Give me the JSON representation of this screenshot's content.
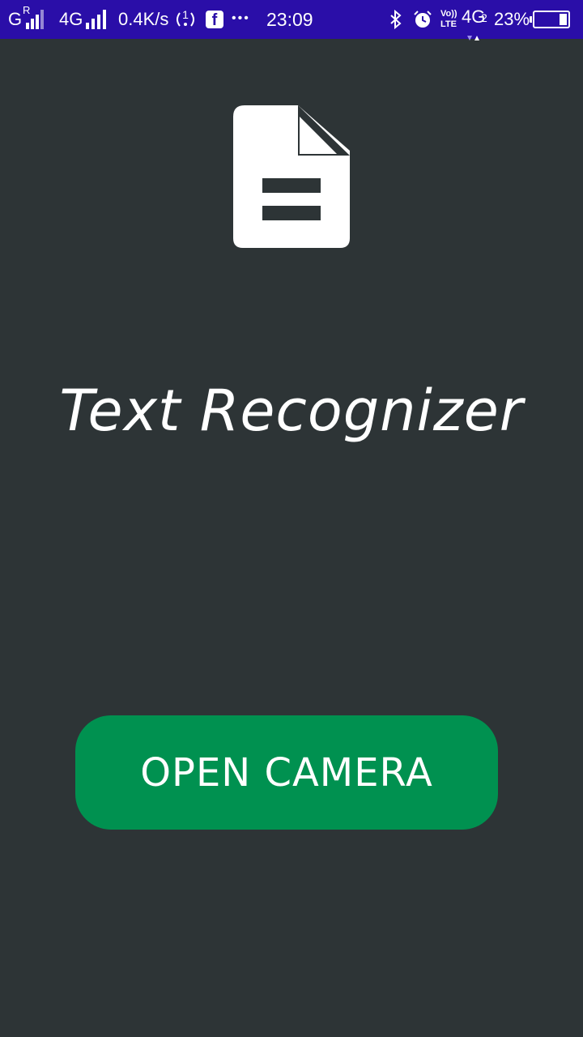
{
  "status_bar": {
    "carrier1_label": "G",
    "carrier1_sup": "R",
    "network_type": "4G",
    "speed": "0.4K/s",
    "hotspot_label": "1",
    "more_label": "•••",
    "time": "23:09",
    "volte_top": "Vo))",
    "volte_bottom": "LTE",
    "network_type2": "4G",
    "sim_index": "2",
    "battery_percent": "23%",
    "battery_level": 0.23
  },
  "main": {
    "icon": "document-icon",
    "title": "Text Recognizer",
    "open_camera_label": "OPEN CAMERA"
  },
  "colors": {
    "status_bar_bg": "#2a0ea8",
    "background": "#2d3436",
    "button": "#009150",
    "text": "#ffffff"
  }
}
